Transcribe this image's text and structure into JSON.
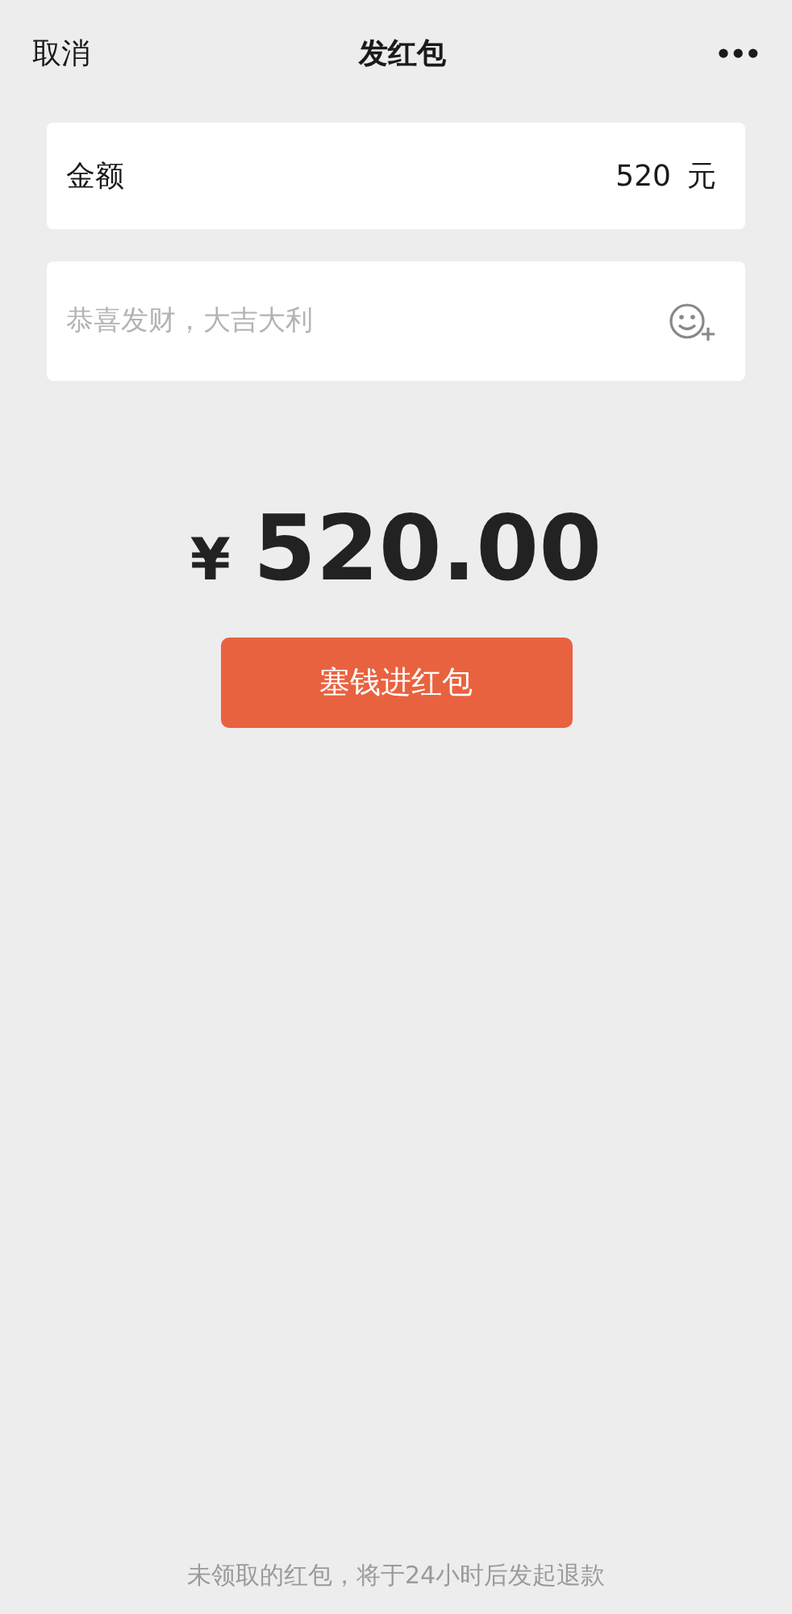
{
  "header": {
    "cancel": "取消",
    "title": "发红包",
    "more": "•••"
  },
  "amount_field": {
    "label": "金额",
    "value": "520",
    "unit": "元"
  },
  "message_field": {
    "placeholder": "恭喜发财，大吉大利"
  },
  "total": {
    "currency": "¥",
    "amount": "520.00"
  },
  "submit_button": "塞钱进红包",
  "footer_note": "未领取的红包，将于24小时后发起退款"
}
